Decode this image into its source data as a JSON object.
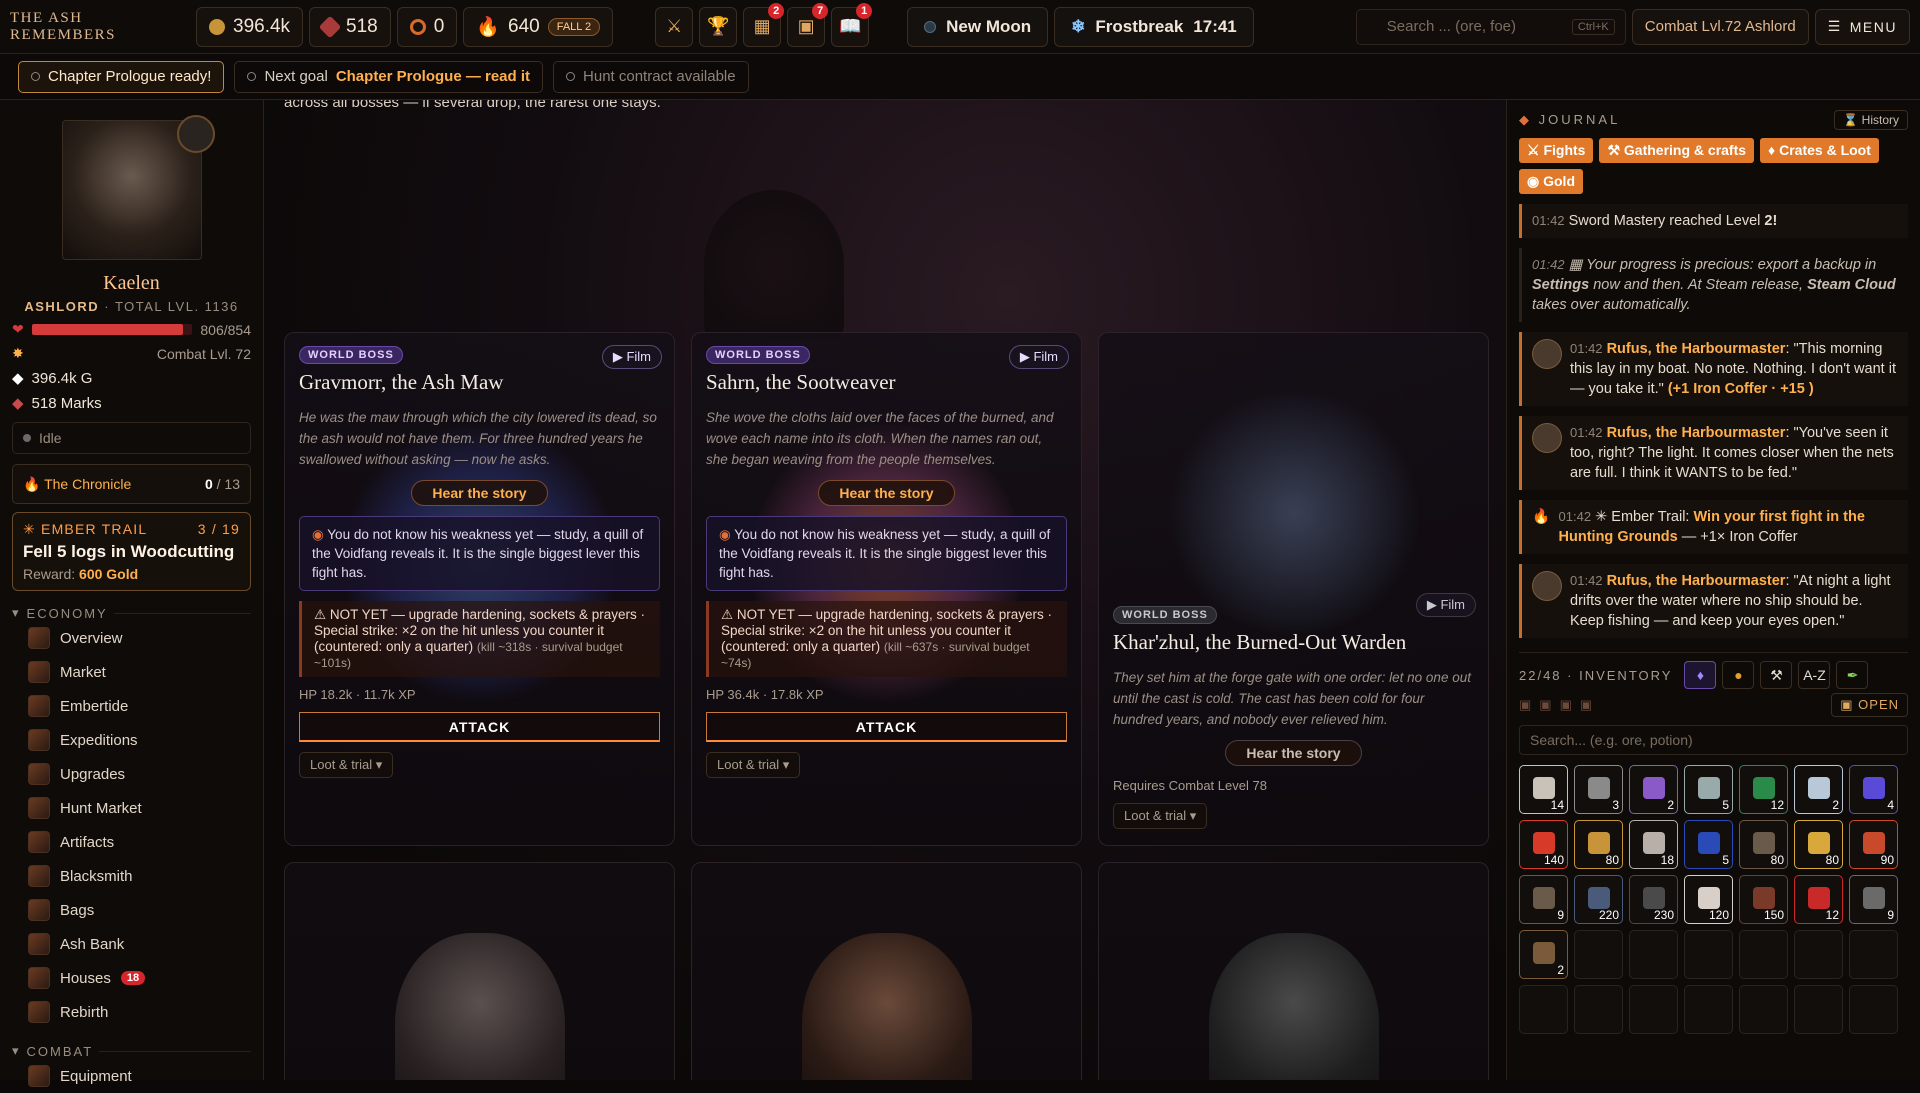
{
  "app": {
    "title": "The Ash Remembers"
  },
  "topbar": {
    "gold": "396.4k",
    "marks": "518",
    "tokens": "0",
    "embers": "640",
    "season": "FALL 2",
    "badges": {
      "quests": "2",
      "crates": "7",
      "codex": "1"
    },
    "moon": "New Moon",
    "weather": "Frostbreak",
    "clock": "17:41",
    "search_placeholder": "Search ... (ore, foe)",
    "search_shortcut": "Ctrl+K",
    "combat_label": "Combat Lvl.72 Ashlord",
    "menu_label": "MENU"
  },
  "notifications": {
    "chapter": "Chapter Prologue ready!",
    "next_goal_label": "Next goal",
    "next_goal_value": "Chapter Prologue — read it",
    "hunt": "Hunt contract available"
  },
  "hero": {
    "name": "Kaelen",
    "title": "ASHLORD",
    "total_level": "TOTAL LVL. 1136",
    "hp_text": "806/854",
    "hp_fraction": 0.944,
    "combat_level": "Combat Lvl. 72",
    "gold": "396.4k G",
    "marks": "518 Marks",
    "status": "Idle",
    "chronicle_label": "The Chronicle",
    "chronicle_progress": "0",
    "chronicle_total": "/ 13",
    "ember_label": "EMBER TRAIL",
    "ember_progress": "3 / 19",
    "ember_goal": "Fell 5 logs in Woodcutting",
    "ember_reward_label": "Reward:",
    "ember_reward": "600 Gold"
  },
  "sidebar": {
    "economy_label": "ECONOMY",
    "economy_items": [
      "Overview",
      "Market",
      "Embertide",
      "Expeditions",
      "Upgrades",
      "Hunt Market",
      "Artifacts",
      "Blacksmith",
      "Bags",
      "Ash Bank",
      "Houses",
      "Rebirth"
    ],
    "houses_badge": "18",
    "combat_label": "COMBAT",
    "combat_items": [
      "Equipment"
    ]
  },
  "main": {
    "intro": "across all bosses — if several drop, the rarest one stays.",
    "world_boss_tag": "WORLD BOSS",
    "film_label": "Film",
    "story_label": "Hear the story",
    "attack_label": "ATTACK",
    "loot_label": "Loot & trial",
    "bosses": [
      {
        "name": "Gravmorr, the Ash Maw",
        "lore": "He was the maw through which the city lowered its dead, so the ash would not have them. For three hundred years he swallowed without asking — now he asks.",
        "weakness": "You do not know his weakness yet — study, a quill of the Voidfang reveals it. It is the single biggest lever this fight has.",
        "notyet": "NOT YET — upgrade hardening, sockets & prayers · Special strike: ×2 on the hit unless you counter it (countered: only a quarter)",
        "notyet_small": "(kill ~318s · survival budget ~101s)",
        "stats": "HP 18.2k · 11.7k XP"
      },
      {
        "name": "Sahrn, the Sootweaver",
        "lore": "She wove the cloths laid over the faces of the burned, and wove each name into its cloth. When the names ran out, she began weaving from the people themselves.",
        "weakness": "You do not know his weakness yet — study, a quill of the Voidfang reveals it. It is the single biggest lever this fight has.",
        "notyet": "NOT YET — upgrade hardening, sockets & prayers · Special strike: ×2 on the hit unless you counter it (countered: only a quarter)",
        "notyet_small": "(kill ~637s · survival budget ~74s)",
        "stats": "HP 36.4k · 17.8k XP"
      },
      {
        "name": "Khar'zhul, the Burned-Out Warden",
        "lore": "They set him at the forge gate with one order: let no one out until the cast is cold. The cast has been cold for four hundred years, and nobody ever relieved him.",
        "requirement": "Requires Combat Level 78"
      }
    ]
  },
  "journal": {
    "title": "JOURNAL",
    "history_label": "History",
    "filters": [
      "Fights",
      "Gathering & crafts",
      "Crates & Loot",
      "Gold"
    ],
    "entries": [
      {
        "time": "01:42",
        "text": "Sword Mastery reached Level ",
        "strong": "2!"
      },
      {
        "time": "01:42",
        "text_a": "Your progress is precious: export a backup in ",
        "settings": "Settings",
        "text_b": " now and then. At Steam release, ",
        "cloud": "Steam Cloud",
        "text_c": " takes over automatically."
      },
      {
        "time": "01:42",
        "who": "Rufus, the Harbourmaster",
        "text": ": \"This morning this lay in my boat. No note. Nothing. I don't want it — you take it.\" ",
        "reward": "(+1 Iron Coffer · +15 )"
      },
      {
        "time": "01:42",
        "who": "Rufus, the Harbourmaster",
        "text": ": \"You've seen it too, right? The light. It comes closer when the nets are full. I think it WANTS to be fed.\""
      },
      {
        "time": "01:42",
        "trail": "Ember Trail: ",
        "goal": "Win your first fight in the Hunting Grounds",
        "text": " — +1× Iron Coffer"
      },
      {
        "time": "01:42",
        "who": "Rufus, the Harbourmaster",
        "text": ": \"At night a light drifts over the water where no ship should be. Keep fishing — and keep your eyes open.\""
      }
    ]
  },
  "inventory": {
    "label": "22/48 · INVENTORY",
    "sort_label": "A-Z",
    "open_label": "OPEN",
    "search_placeholder": "Search... (e.g. ore, potion)",
    "items": [
      {
        "count": "14",
        "color": "#c9c2b8"
      },
      {
        "count": "3",
        "color": "#8a8a8a"
      },
      {
        "count": "2",
        "color": "#8a5ac8"
      },
      {
        "count": "5",
        "color": "#9aa"
      },
      {
        "count": "12",
        "color": "#2a8a4a"
      },
      {
        "count": "2",
        "color": "#b8c8d8"
      },
      {
        "count": "4",
        "color": "#5a4ad8"
      },
      {
        "count": "140",
        "color": "#d83a2a"
      },
      {
        "count": "80",
        "color": "#c8943a"
      },
      {
        "count": "18",
        "color": "#b8b0a8"
      },
      {
        "count": "5",
        "color": "#2a4ab8"
      },
      {
        "count": "80",
        "color": "#6a5a4a"
      },
      {
        "count": "80",
        "color": "#d8a83a"
      },
      {
        "count": "90",
        "color": "#c84a2a"
      },
      {
        "count": "9",
        "color": "#6a5a4a"
      },
      {
        "count": "220",
        "color": "#4a5a7a"
      },
      {
        "count": "230",
        "color": "#4a4a4a"
      },
      {
        "count": "120",
        "color": "#d8d0c8"
      },
      {
        "count": "150",
        "color": "#7a3a2a"
      },
      {
        "count": "12",
        "color": "#c82a2a"
      },
      {
        "count": "9",
        "color": "#6a6a6a"
      },
      {
        "count": "2",
        "color": "#7a5a3a"
      }
    ]
  }
}
